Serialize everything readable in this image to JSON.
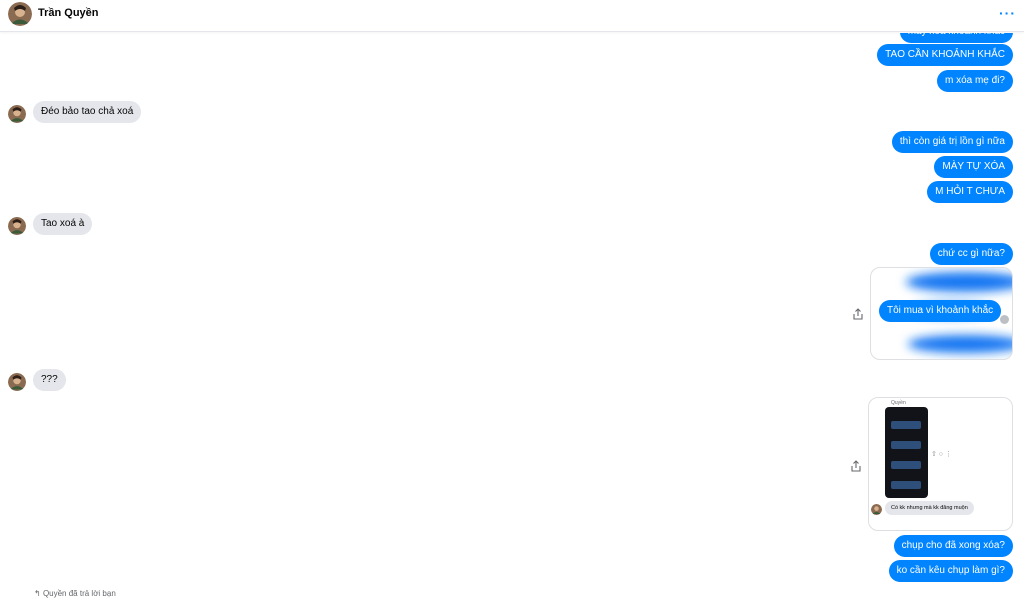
{
  "contact": {
    "name": "Trần Quyền"
  },
  "header": {
    "more_label": "···"
  },
  "messages_top": [
    {
      "text": "mày xoá khoảnh khắc"
    },
    {
      "text": "TAO CẦN KHOẢNH KHẮC"
    },
    {
      "text": "m xóa mẹ đi?"
    }
  ],
  "incoming_1": {
    "text": "Đéo bảo tao chả xoá"
  },
  "messages_mid": [
    {
      "text": "thì còn giá trị lồn gì nữa"
    },
    {
      "text": "MÀY TỰ XÓA"
    },
    {
      "text": "M HỎI T CHƯA"
    }
  ],
  "incoming_2": {
    "text": "Tao xoá à"
  },
  "outgoing_q": {
    "text": "chứ cc gì nữa?"
  },
  "attachment_1": {
    "caption": "Tôi mua vì khoảnh khắc"
  },
  "incoming_3": {
    "text": "???"
  },
  "attachment_2": {
    "sender_label": "Quyền",
    "reply_text": "Có kk nhưng mà kk đăng muộn"
  },
  "messages_bottom": [
    {
      "text": "chụp cho đã xong xóa?"
    },
    {
      "text": "ko cần kêu chụp làm gì?"
    }
  ],
  "footer": {
    "reply_note": "Quyền đã trả lời bạn"
  },
  "colors": {
    "accent": "#0084ff",
    "incoming": "#e4e6eb"
  }
}
